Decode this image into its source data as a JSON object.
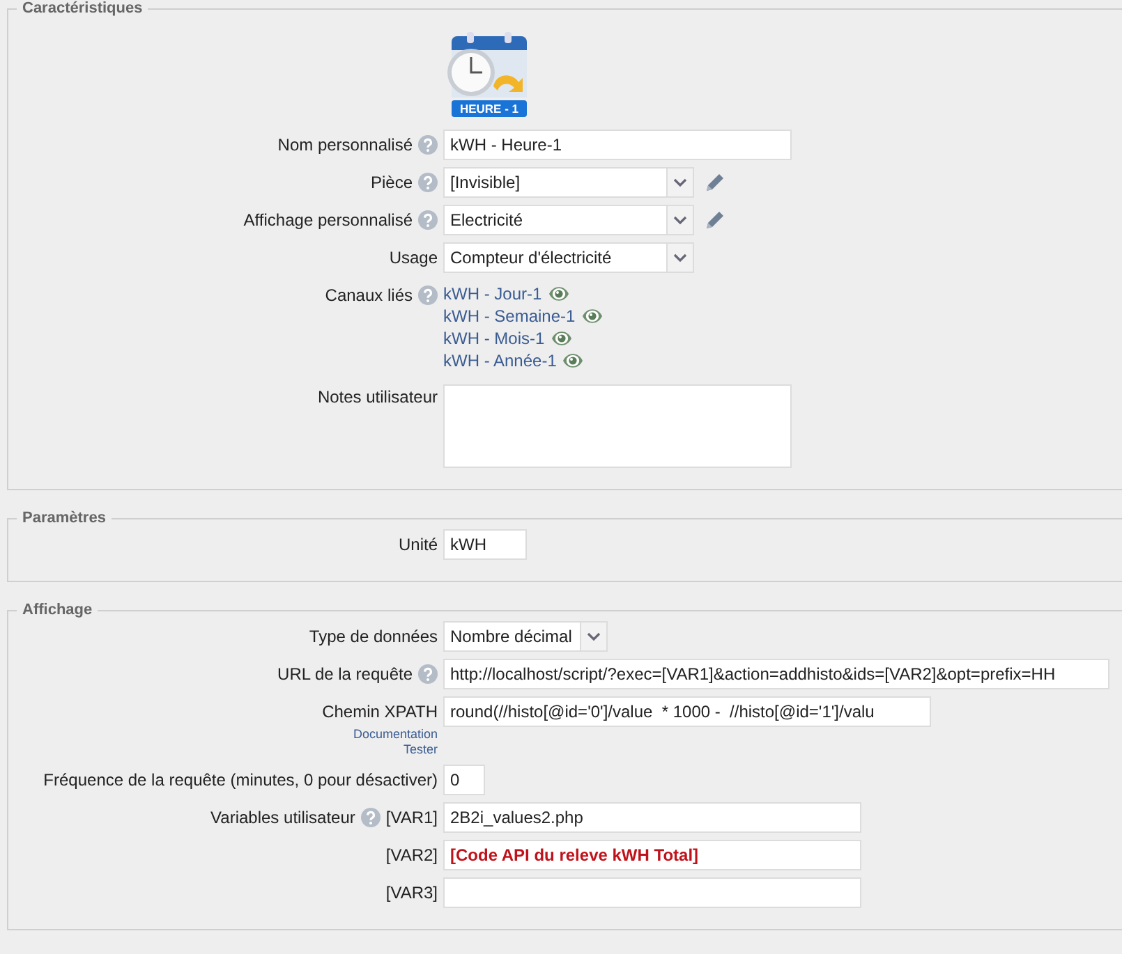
{
  "sections": [
    {
      "legend": "Caractéristiques",
      "badge": {
        "label": "HEURE - 1"
      },
      "fields": [
        {
          "kind": "text",
          "label": "Nom personnalisé",
          "help": true,
          "value": "kWH - Heure-1"
        },
        {
          "kind": "select",
          "label": "Pièce",
          "help": true,
          "value": "[Invisible]",
          "editable": true
        },
        {
          "kind": "select",
          "label": "Affichage personnalisé",
          "help": true,
          "value": "Electricité",
          "editable": true
        },
        {
          "kind": "select",
          "label": "Usage",
          "help": false,
          "value": "Compteur d'électricité",
          "editable": false
        },
        {
          "kind": "links",
          "label": "Canaux liés",
          "help": true,
          "links": [
            "kWH - Jour-1",
            "kWH - Semaine-1",
            "kWH - Mois-1",
            "kWH - Année-1"
          ]
        },
        {
          "kind": "textarea",
          "label": "Notes utilisateur",
          "help": false
        }
      ]
    },
    {
      "legend": "Paramètres",
      "fields": [
        {
          "kind": "unit",
          "label": "Unité",
          "help": false,
          "value": "kWH"
        }
      ]
    },
    {
      "legend": "Affichage",
      "fields": [
        {
          "kind": "typeselect",
          "label": "Type de données",
          "help": false,
          "value": "Nombre décimal",
          "editable": false
        },
        {
          "kind": "url",
          "label": "URL de la requête",
          "help": true,
          "value": "http://localhost/script/?exec=[VAR1]&action=addhisto&ids=[VAR2]&opt=prefix=HH"
        },
        {
          "kind": "xpath",
          "label": "Chemin XPATH",
          "help": false,
          "sublinks": [
            "Documentation",
            "Tester"
          ],
          "value": "round(//histo[@id='0']/value  * 1000 -  //histo[@id='1']/valu"
        },
        {
          "kind": "number",
          "label": "Fréquence de la requête (minutes, 0 pour désactiver)",
          "help": false,
          "value": "0"
        },
        {
          "kind": "var",
          "label": "Variables utilisateur",
          "help": true,
          "tag": "[VAR1]",
          "value": "2B2i_values2.php",
          "emphasis": false
        },
        {
          "kind": "var",
          "tag": "[VAR2]",
          "value": "[Code API du releve kWH Total]",
          "emphasis": true
        },
        {
          "kind": "var",
          "tag": "[VAR3]"
        }
      ]
    }
  ]
}
